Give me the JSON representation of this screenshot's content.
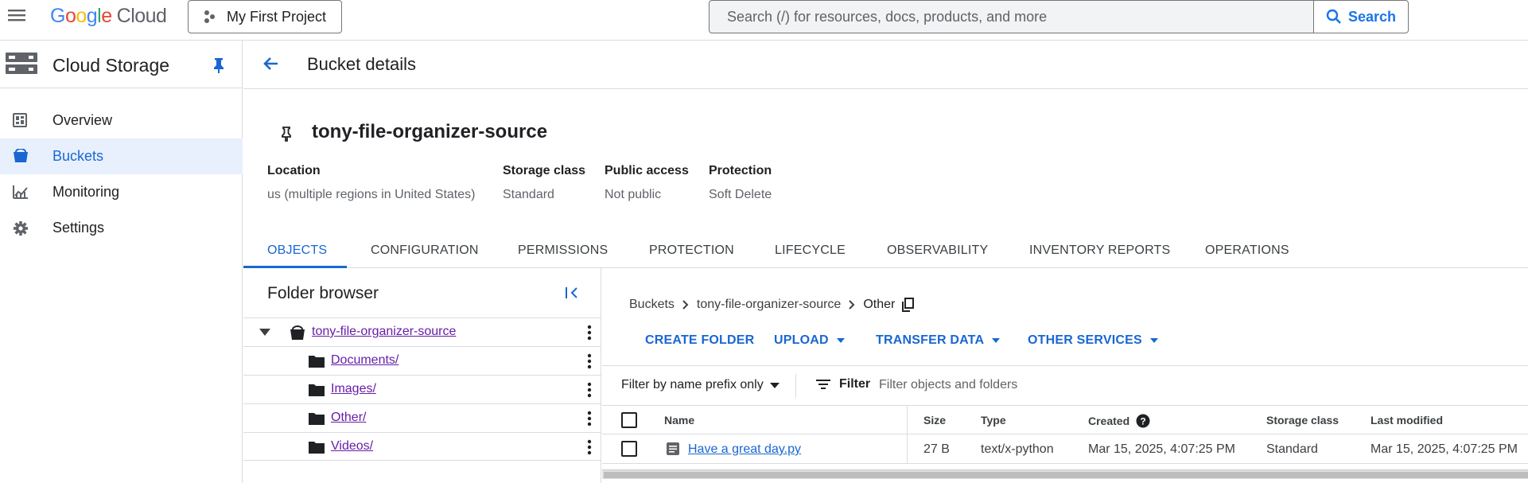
{
  "topbar": {
    "logo_google": "Google",
    "logo_cloud": "Cloud",
    "project": "My First Project",
    "search_placeholder": "Search (/) for resources, docs, products, and more",
    "search_button": "Search"
  },
  "sidebar": {
    "product": "Cloud Storage",
    "items": [
      {
        "label": "Overview",
        "icon": "dashboard-icon"
      },
      {
        "label": "Buckets",
        "icon": "bucket-icon",
        "active": true
      },
      {
        "label": "Monitoring",
        "icon": "chart-icon"
      },
      {
        "label": "Settings",
        "icon": "gear-icon"
      }
    ]
  },
  "header": {
    "title": "Bucket details"
  },
  "bucket": {
    "name": "tony-file-organizer-source",
    "properties": [
      {
        "label": "Location",
        "value": "us (multiple regions in United States)"
      },
      {
        "label": "Storage class",
        "value": "Standard"
      },
      {
        "label": "Public access",
        "value": "Not public"
      },
      {
        "label": "Protection",
        "value": "Soft Delete"
      }
    ]
  },
  "tabs": [
    "OBJECTS",
    "CONFIGURATION",
    "PERMISSIONS",
    "PROTECTION",
    "LIFECYCLE",
    "OBSERVABILITY",
    "INVENTORY REPORTS",
    "OPERATIONS"
  ],
  "folder_browser": {
    "title": "Folder browser",
    "root": "tony-file-organizer-source",
    "folders": [
      "Documents/",
      "Images/",
      "Other/",
      "Videos/"
    ]
  },
  "objects": {
    "breadcrumb": [
      "Buckets",
      "tony-file-organizer-source",
      "Other"
    ],
    "actions": [
      "CREATE FOLDER",
      "UPLOAD",
      "TRANSFER DATA",
      "OTHER SERVICES"
    ],
    "filter_mode": "Filter by name prefix only",
    "filter_label": "Filter",
    "filter_placeholder": "Filter objects and folders",
    "columns": [
      "Name",
      "Size",
      "Type",
      "Created",
      "Storage class",
      "Last modified"
    ],
    "rows": [
      {
        "name": "Have a great day.py",
        "size": "27 B",
        "type": "text/x-python",
        "created": "Mar 15, 2025, 4:07:25 PM",
        "storage_class": "Standard",
        "last_modified": "Mar 15, 2025, 4:07:25 PM"
      }
    ]
  },
  "colors": {
    "accent": "#1967d2",
    "visited_link": "#681da8",
    "active_nav_bg": "#e8f0fe"
  }
}
